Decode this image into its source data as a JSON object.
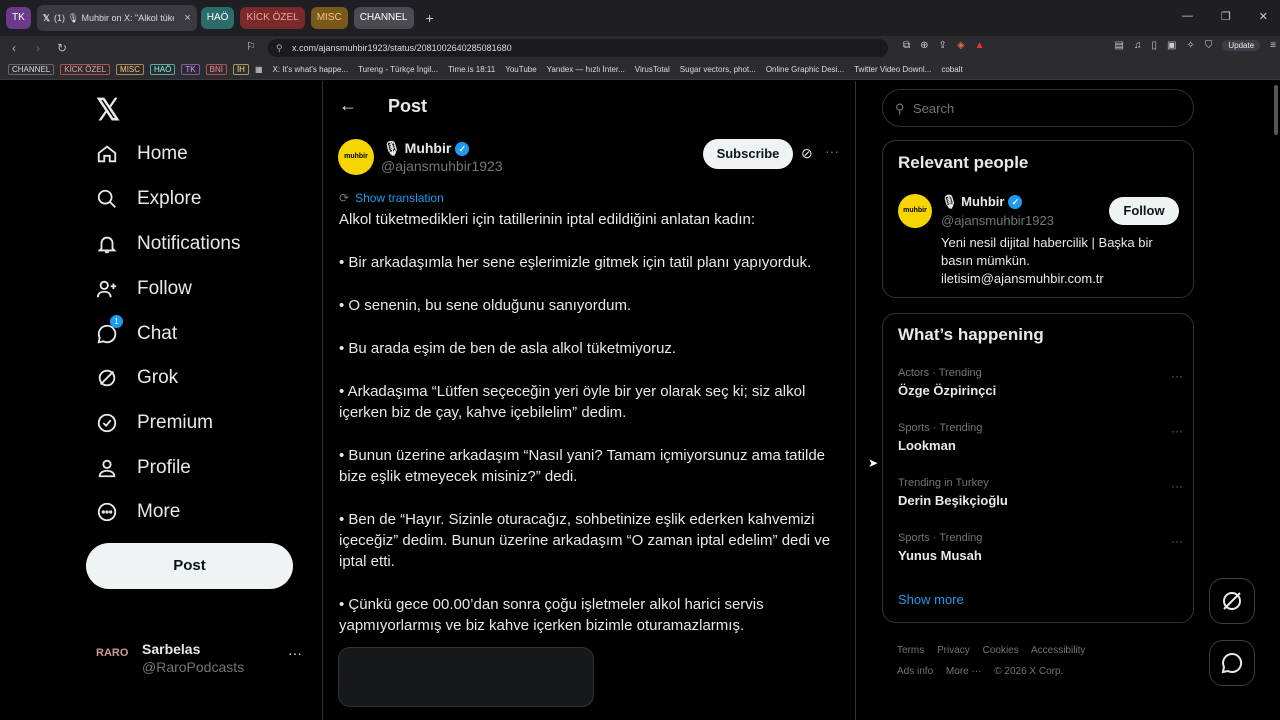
{
  "browser": {
    "tab_groups": [
      {
        "label": "TK",
        "color": "#6b3a8a"
      },
      {
        "label": "HAÖ",
        "color": "#2a6b6b"
      },
      {
        "label": "KİCK ÖZEL",
        "color": "#7a2a2a"
      },
      {
        "label": "MISC",
        "color": "#7a5a1a"
      },
      {
        "label": "CHANNEL",
        "color": "#4a4a52"
      }
    ],
    "active_tab": "(1) 🎙 Muhbir on X: \"Alkol tüket…",
    "url": "x.com/ajansmuhbir1923/status/2081002640285081680",
    "update_label": "Update",
    "bookmark_groups": [
      "CHANNEL",
      "KİCK ÖZEL",
      "MISC",
      "HAÖ",
      "TK",
      "BNİ",
      "İH"
    ],
    "bookmarks": [
      "X: It's what's happe...",
      "Tureng - Türkçe İngil...",
      "Time.is 18:11",
      "YouTube",
      "Yandex — hızlı İnter...",
      "VirusTotal",
      "Sugar vectors, phot...",
      "Online Graphic Desi...",
      "Twitter Video Downl...",
      "cobalt"
    ]
  },
  "nav": {
    "items": [
      "Home",
      "Explore",
      "Notifications",
      "Follow",
      "Chat",
      "Grok",
      "Premium",
      "Profile",
      "More"
    ],
    "chat_badge": "1",
    "post_button": "Post",
    "account": {
      "avatar": "RARO",
      "name": "Sarbelas",
      "handle": "@RaroPodcasts",
      "more": "···"
    }
  },
  "post": {
    "header_title": "Post",
    "author_name": "🎙 Muhbir",
    "author_handle": "@ajansmuhbir1923",
    "avatar_text": "muhbir",
    "subscribe": "Subscribe",
    "show_translation": "Show translation",
    "paragraphs": [
      "Alkol tüketmedikleri için tatillerinin iptal edildiğini anlatan kadın:",
      "• Bir arkadaşımla her sene eşlerimizle gitmek için tatil planı yapıyorduk.",
      "• O senenin, bu sene olduğunu sanıyordum.",
      "• Bu arada eşim de ben de asla alkol tüketmiyoruz.",
      "• Arkadaşıma “Lütfen seçeceğin yeri öyle bir yer olarak seç ki; siz alkol içerken biz de çay, kahve içebilelim” dedim.",
      "• Bunun üzerine arkadaşım “Nasıl yani? Tamam içmiyorsunuz ama tatilde bize eşlik etmeyecek misiniz?” dedi.",
      "• Ben de “Hayır. Sizinle oturacağız, sohbetinize eşlik ederken kahvemizi içeceğiz” dedim. Bunun üzerine arkadaşım “O zaman iptal edelim” dedi ve iptal etti.",
      "• Çünkü gece 00.00’dan sonra çoğu işletmeler alkol harici servis yapmıyorlarmış ve biz kahve içerken bizimle oturamazlarmış."
    ]
  },
  "sidebar": {
    "search_placeholder": "Search",
    "relevant_title": "Relevant people",
    "relevant": {
      "name": "🎙 Muhbir",
      "handle": "@ajansmuhbir1923",
      "bio": "Yeni nesil dijital habercilik | Başka bir basın mümkün. iletisim@ajansmuhbir.com.tr",
      "follow": "Follow"
    },
    "happening_title": "What’s happening",
    "trends": [
      {
        "context": "Actors · Trending",
        "title": "Özge Özpirinçci"
      },
      {
        "context": "Sports · Trending",
        "title": "Lookman"
      },
      {
        "context": "Trending in Turkey",
        "title": "Derin Beşikçioğlu"
      },
      {
        "context": "Sports · Trending",
        "title": "Yunus Musah"
      }
    ],
    "show_more": "Show more",
    "footer": [
      "Terms",
      "Privacy",
      "Cookies",
      "Accessibility",
      "Ads info",
      "More ···",
      "© 2026 X Corp."
    ]
  }
}
